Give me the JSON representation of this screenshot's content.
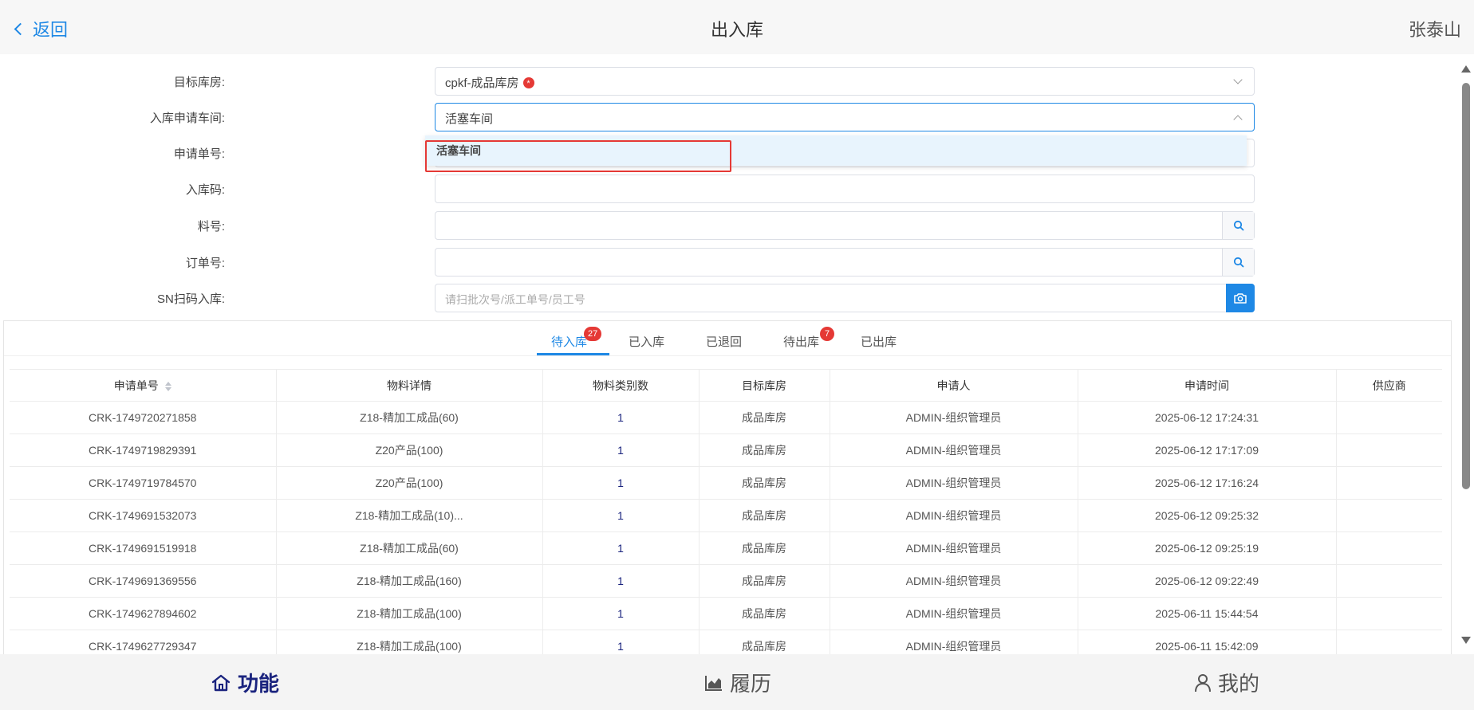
{
  "header": {
    "back_label": "返回",
    "title": "出入库",
    "user_name": "张泰山"
  },
  "form": {
    "target_warehouse": {
      "label": "目标库房:",
      "value": "cpkf-成品库房",
      "required_mark": "*"
    },
    "workshop": {
      "label": "入库申请车间:",
      "value": "活塞车间"
    },
    "request_no": {
      "label": "申请单号:",
      "value": ""
    },
    "inbound_code": {
      "label": "入库码:",
      "value": ""
    },
    "material_no": {
      "label": "料号:",
      "value": ""
    },
    "order_no": {
      "label": "订单号:",
      "value": ""
    },
    "sn_scan": {
      "label": "SN扫码入库:",
      "placeholder": "请扫批次号/派工单号/员工号"
    }
  },
  "dropdown": {
    "options": [
      "活塞车间"
    ]
  },
  "tabs": [
    {
      "label": "待入库",
      "count": "27",
      "active": true
    },
    {
      "label": "已入库",
      "count": null
    },
    {
      "label": "已退回",
      "count": null
    },
    {
      "label": "待出库",
      "count": "7"
    },
    {
      "label": "已出库",
      "count": null
    }
  ],
  "table": {
    "columns": [
      "申请单号",
      "物料详情",
      "物料类别数",
      "目标库房",
      "申请人",
      "申请时间",
      "供应商"
    ],
    "rows": [
      [
        "CRK-1749720271858",
        "Z18-精加工成品(60)",
        "1",
        "成品库房",
        "ADMIN-组织管理员",
        "2025-06-12 17:24:31",
        ""
      ],
      [
        "CRK-1749719829391",
        "Z20产品(100)",
        "1",
        "成品库房",
        "ADMIN-组织管理员",
        "2025-06-12 17:17:09",
        ""
      ],
      [
        "CRK-1749719784570",
        "Z20产品(100)",
        "1",
        "成品库房",
        "ADMIN-组织管理员",
        "2025-06-12 17:16:24",
        ""
      ],
      [
        "CRK-1749691532073",
        "Z18-精加工成品(10)...",
        "1",
        "成品库房",
        "ADMIN-组织管理员",
        "2025-06-12 09:25:32",
        ""
      ],
      [
        "CRK-1749691519918",
        "Z18-精加工成品(60)",
        "1",
        "成品库房",
        "ADMIN-组织管理员",
        "2025-06-12 09:25:19",
        ""
      ],
      [
        "CRK-1749691369556",
        "Z18-精加工成品(160)",
        "1",
        "成品库房",
        "ADMIN-组织管理员",
        "2025-06-12 09:22:49",
        ""
      ],
      [
        "CRK-1749627894602",
        "Z18-精加工成品(100)",
        "1",
        "成品库房",
        "ADMIN-组织管理员",
        "2025-06-11 15:44:54",
        ""
      ],
      [
        "CRK-1749627729347",
        "Z18-精加工成品(100)",
        "1",
        "成品库房",
        "ADMIN-组织管理员",
        "2025-06-11 15:42:09",
        ""
      ]
    ]
  },
  "bottom_nav": [
    {
      "label": "功能",
      "icon": "home-icon",
      "active": true
    },
    {
      "label": "履历",
      "icon": "chart-icon",
      "active": false
    },
    {
      "label": "我的",
      "icon": "user-icon",
      "active": false
    }
  ],
  "colors": {
    "accent": "#1e88e5",
    "badge": "#e53935",
    "nav_active": "#1a237e",
    "dropdown_highlight": "#e8f4fd"
  }
}
